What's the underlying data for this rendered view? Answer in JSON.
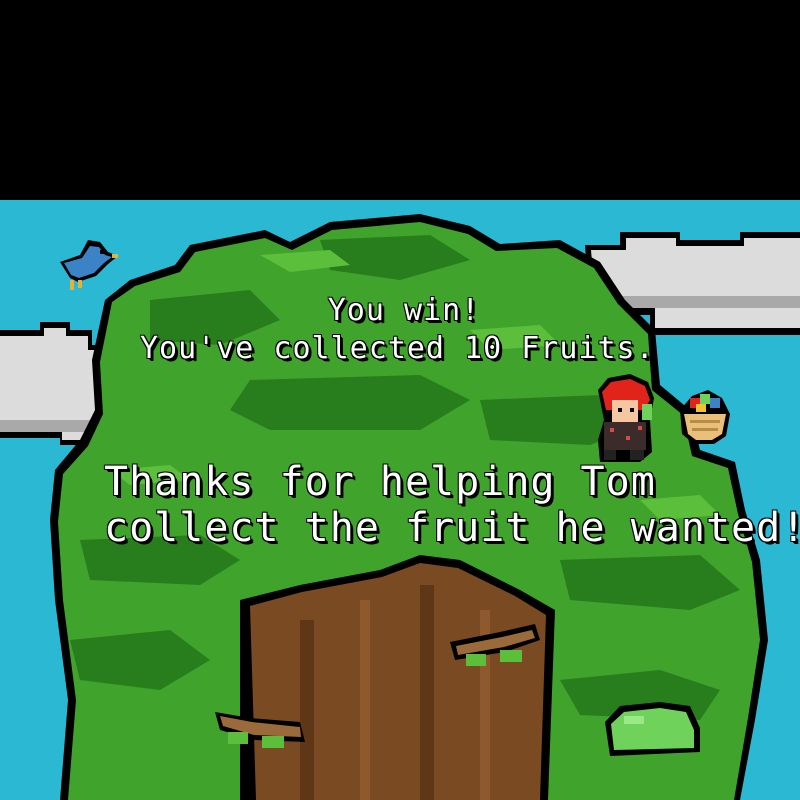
{
  "end_screen": {
    "win_text": "You win!",
    "collected_text": "You've collected 10 Fruits.",
    "thanks_line_1": "Thanks for helping Tom",
    "thanks_line_2": "collect the fruit he wanted!"
  },
  "colors": {
    "sky": "#2bb8d2",
    "top_band": "#000000",
    "cloud": "#dcdcdc",
    "foliage": "#3fa32c",
    "foliage_dark": "#287d1c",
    "trunk": "#7a4a22",
    "text": "#ffffff"
  }
}
